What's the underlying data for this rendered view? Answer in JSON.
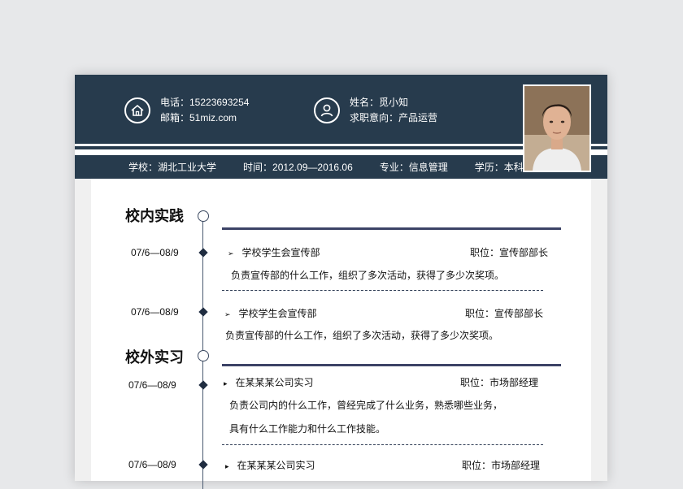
{
  "header": {
    "phone": "电话：15223693254",
    "email": "邮箱：51miz.com",
    "name": "姓名：觅小知",
    "job_intent": "求职意向：产品运营",
    "contact_icon": "home-icon",
    "person_icon": "user-icon"
  },
  "info": {
    "school": "学校：湖北工业大学",
    "period": "时间：2012.09—2016.06",
    "major": "专业：信息管理",
    "degree": "学历：本科"
  },
  "sections": [
    {
      "title": "校内实践",
      "entries": [
        {
          "date": "07/6—08/9",
          "bullet": "➢",
          "org": "学校学生会宣传部",
          "position": "职位：宣传部部长",
          "desc": [
            "负责宣传部的什么工作，组织了多次活动，获得了多少次奖项。"
          ]
        },
        {
          "date": "07/6—08/9",
          "bullet": "➢",
          "org": "学校学生会宣传部",
          "position": "职位：宣传部部长",
          "desc": [
            "负责宣传部的什么工作，组织了多次活动，获得了多少次奖项。"
          ]
        }
      ]
    },
    {
      "title": "校外实习",
      "entries": [
        {
          "date": "07/6—08/9",
          "bullet": "▸",
          "org": "在某某某公司实习",
          "position": "职位：市场部经理",
          "desc": [
            "负责公司内的什么工作，曾经完成了什么业务，熟悉哪些业务，",
            "具有什么工作能力和什么工作技能。"
          ]
        },
        {
          "date": "07/6—08/9",
          "bullet": "▸",
          "org": "在某某某公司实习",
          "position": "职位：市场部经理",
          "desc": []
        }
      ]
    }
  ],
  "colors": {
    "header_navy": "#273b4d",
    "rule_indigo": "#3c4366",
    "background": "#e7e8ea"
  }
}
